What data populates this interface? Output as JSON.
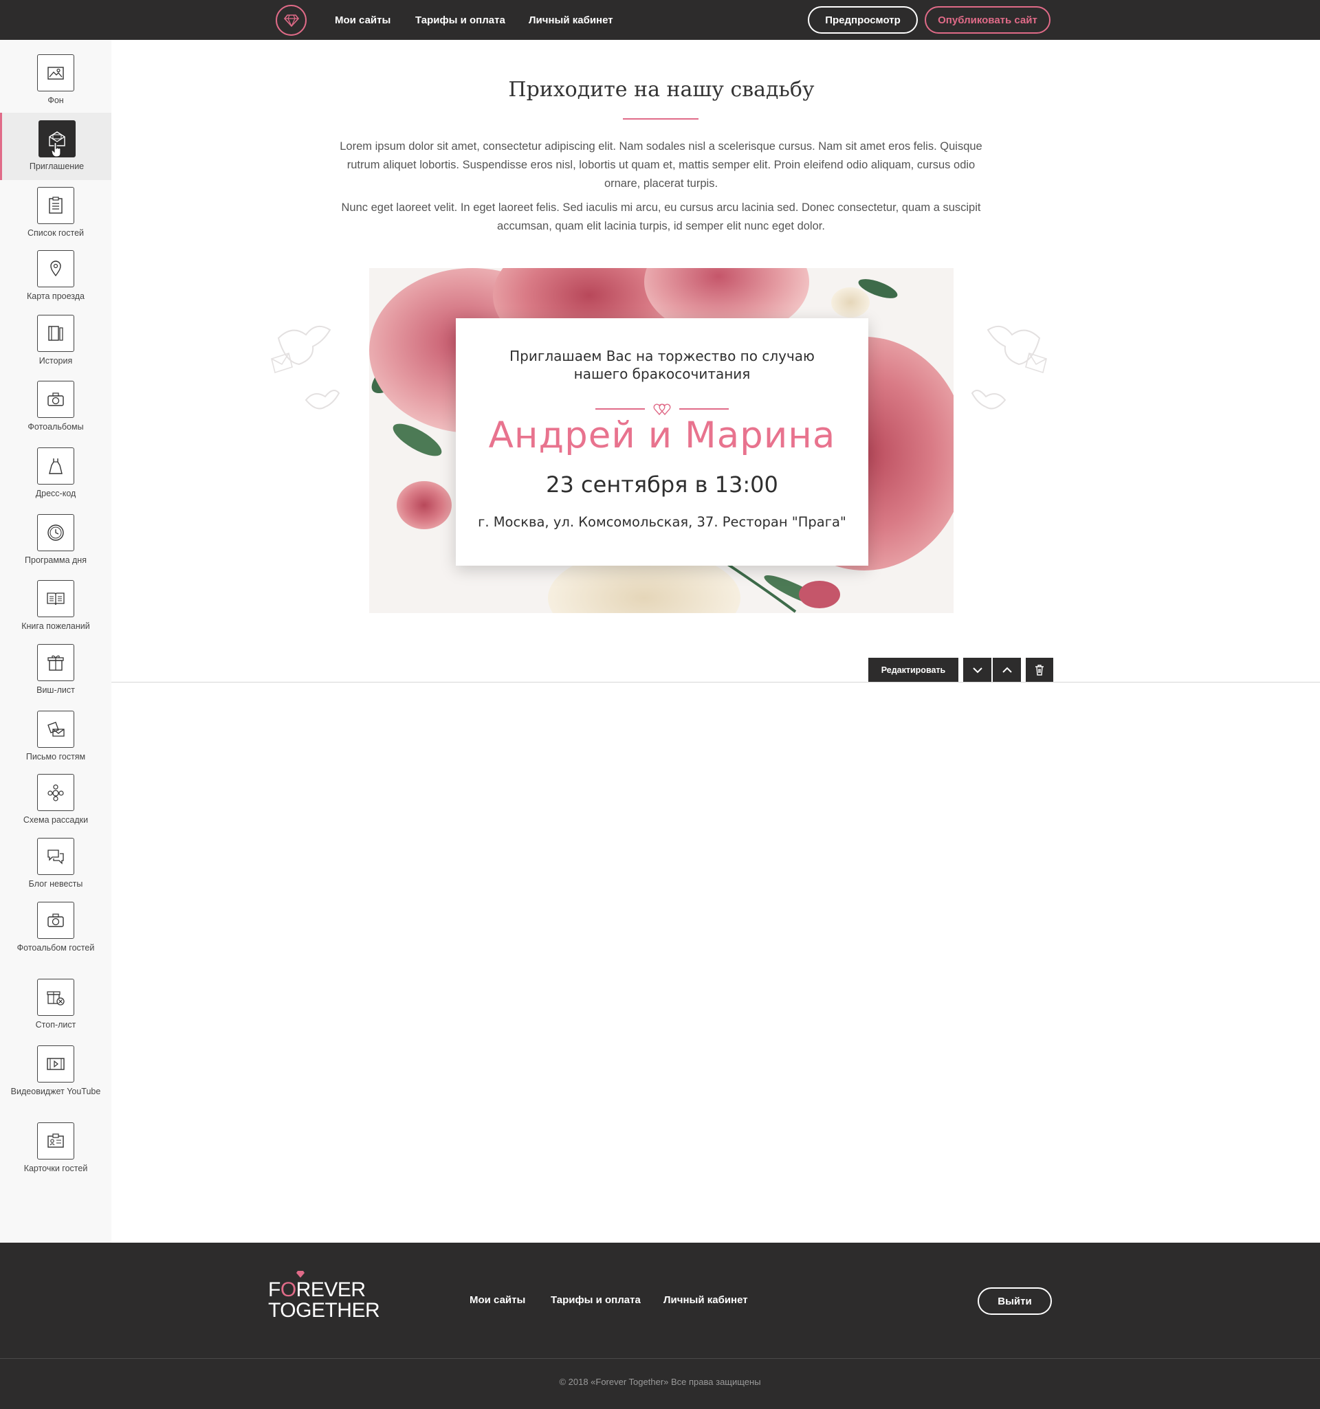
{
  "header": {
    "nav": [
      "Мои сайты",
      "Тарифы и оплата",
      "Личный кабинет"
    ],
    "preview_label": "Предпросмотр",
    "publish_label": "Опубликовать сайт"
  },
  "sidebar": {
    "items": [
      {
        "label": "Фон",
        "icon": "image-icon"
      },
      {
        "label": "Приглашение",
        "icon": "envelope-icon",
        "active": true
      },
      {
        "label": "Список гостей",
        "icon": "clipboard-list-icon"
      },
      {
        "label": "Карта проезда",
        "icon": "map-pin-icon"
      },
      {
        "label": "История",
        "icon": "book-icon"
      },
      {
        "label": "Фотоальбомы",
        "icon": "camera-icon"
      },
      {
        "label": "Дресс-код",
        "icon": "dress-icon"
      },
      {
        "label": "Программа дня",
        "icon": "clock-icon"
      },
      {
        "label": "Книга пожеланий",
        "icon": "open-book-icon"
      },
      {
        "label": "Виш-лист",
        "icon": "gift-icon"
      },
      {
        "label": "Письмо гостям",
        "icon": "letters-icon"
      },
      {
        "label": "Схема рассадки",
        "icon": "seating-icon"
      },
      {
        "label": "Блог невесты",
        "icon": "chat-icon"
      },
      {
        "label": "Фотоальбом гостей",
        "icon": "camera-icon"
      },
      {
        "label": "Стоп-лист",
        "icon": "gift-cancel-icon"
      },
      {
        "label": "Видеовиджет YouTube",
        "icon": "video-icon"
      },
      {
        "label": "Карточки гостей",
        "icon": "id-card-icon"
      }
    ]
  },
  "main": {
    "title": "Приходите на нашу свадьбу",
    "paragraphs": [
      "Lorem ipsum dolor sit amet, consectetur adipiscing elit. Nam sodales nisl a scelerisque cursus. Nam sit amet eros felis. Quisque rutrum aliquet lobortis. Suspendisse eros nisl, lobortis ut quam et, mattis semper elit. Proin eleifend odio aliquam, cursus odio ornare, placerat turpis.",
      "Nunc eget laoreet velit. In eget laoreet felis. Sed iaculis mi arcu, eu cursus arcu lacinia sed. Donec consectetur, quam a suscipit accumsan, quam elit lacinia turpis, id semper elit nunc eget dolor."
    ],
    "invite": {
      "lead_line1": "Приглашаем Вас на торжество по случаю",
      "lead_line2": "нашего бракосочитания",
      "names": "Андрей и Марина",
      "date": "23 сентября в 13:00",
      "place": "г. Москва, ул. Комсомольская, 37. Ресторан \"Прага\""
    },
    "edit_label": "Редактировать"
  },
  "footer": {
    "logo_line1_a": "F",
    "logo_line1_o": "O",
    "logo_line1_b": "REVER",
    "logo_line2": "TOGETHER",
    "nav": [
      "Мои сайты",
      "Тарифы и оплата",
      "Личный кабинет"
    ],
    "logout_label": "Выйти",
    "copyright": "© 2018 «Forever Together» Все права защищены"
  },
  "colors": {
    "accent": "#e06b88",
    "dark": "#2d2c2c"
  }
}
